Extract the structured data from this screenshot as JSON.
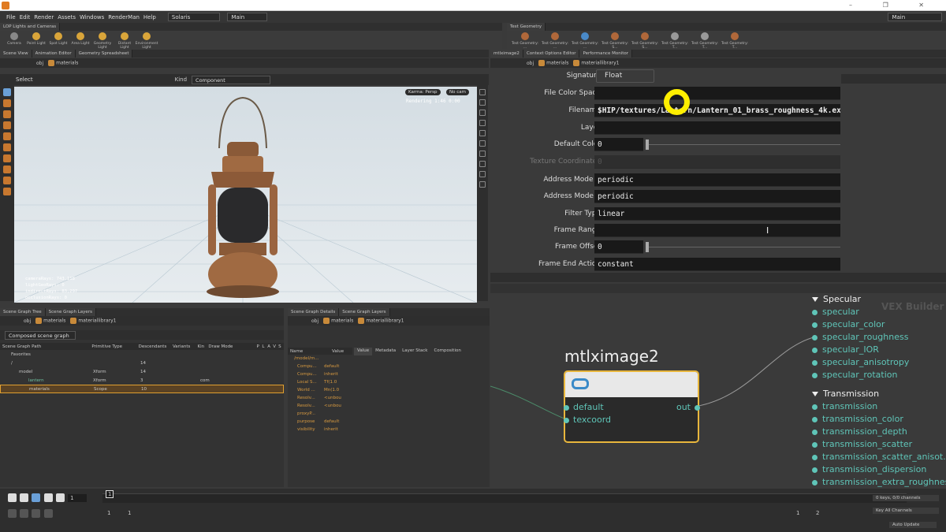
{
  "menu": {
    "items": [
      "File",
      "Edit",
      "Render",
      "Assets",
      "Windows",
      "RenderMan",
      "Help"
    ],
    "desktop_left": "Solaris",
    "desktop_mid": "Main",
    "desktop_right": "Main"
  },
  "shelf_left": {
    "tab": "LOP Lights and Cameras",
    "tools": [
      "Camera",
      "Point Light",
      "Spot Light",
      "Area Light",
      "Geometry Light",
      "Distant Light",
      "Environment Light"
    ]
  },
  "shelf_right": {
    "tab": "Test Geometry",
    "tools": [
      "Test Geometry: ...",
      "Test Geometry: ...",
      "Test Geometry: ...",
      "Test Geometry: S...",
      "Test Geometry: S...",
      "Test Geometry: T...",
      "Test Geometry: T...",
      "Test Geometry: T..."
    ]
  },
  "left_panel": {
    "tabs": [
      "Scene View",
      "Animation Editor",
      "Geometry Spreadsheet"
    ],
    "path": [
      "obj",
      "materials"
    ],
    "select_label": "Select",
    "kind_label": "Kind",
    "kind_value": "Component",
    "camera_menu": "Karma: Persp",
    "cam_menu": "No cam",
    "render_status": "Rendering 1:46 0:00",
    "stats": [
      {
        "label": "cameraRays:",
        "value": "743,118"
      },
      {
        "label": "lightGeoRays:",
        "value": "0"
      },
      {
        "label": "indirectRays:",
        "value": "83,297"
      },
      {
        "label": "occlusionRays:",
        "value": "0"
      }
    ]
  },
  "param_panel": {
    "tabs": [
      "mtlximage2",
      "Context Options Editor",
      "Performance Monitor"
    ],
    "path": [
      "obj",
      "materials",
      "materiallibrary1"
    ],
    "rows": [
      {
        "label": "Signature",
        "value": "Float",
        "kind": "menu"
      },
      {
        "label": "File Color Space",
        "value": "",
        "kind": "field"
      },
      {
        "label": "Filename",
        "value": "$HIP/textures/Lantern/Lantern_01_brass_roughness_4k.exr",
        "kind": "field"
      },
      {
        "label": "Layer",
        "value": "",
        "kind": "field"
      },
      {
        "label": "Default Color",
        "value": "0",
        "kind": "slider"
      },
      {
        "label": "Texture Coordinates",
        "value": "0",
        "kind": "dim"
      },
      {
        "label": "Address Mode U",
        "value": "periodic",
        "kind": "field"
      },
      {
        "label": "Address Mode V",
        "value": "periodic",
        "kind": "field"
      },
      {
        "label": "Filter Type",
        "value": "linear",
        "kind": "field"
      },
      {
        "label": "Frame Range",
        "value": "",
        "kind": "field"
      },
      {
        "label": "Frame Offset",
        "value": "0",
        "kind": "slider"
      },
      {
        "label": "Frame End Action",
        "value": "constant",
        "kind": "field"
      }
    ]
  },
  "network": {
    "node_name": "mtlximage2",
    "inputs": [
      "default",
      "texcoord"
    ],
    "output": "out",
    "builder_label": "VEX Builder",
    "groups": [
      {
        "name": "Specular",
        "items": [
          "specular",
          "specular_color",
          "specular_roughness",
          "specular_IOR",
          "specular_anisotropy",
          "specular_rotation"
        ]
      },
      {
        "name": "Transmission",
        "items": [
          "transmission",
          "transmission_color",
          "transmission_depth",
          "transmission_scatter",
          "transmission_scatter_anisot...",
          "transmission_dispersion",
          "transmission_extra_roughness"
        ]
      }
    ]
  },
  "scene_graph": {
    "tabs": [
      "Scene Graph Tree",
      "Scene Graph Layers"
    ],
    "path": [
      "obj",
      "materials",
      "materiallibrary1"
    ],
    "filter": "Composed scene graph",
    "columns": [
      "Scene Graph Path",
      "Primitive Type",
      "Descendants",
      "Variants",
      "Kin",
      "Draw Mode",
      "P",
      "L",
      "A",
      "V",
      "S"
    ],
    "rows": [
      {
        "name": "Favorites",
        "type": "",
        "desc": "",
        "kind": ""
      },
      {
        "name": "/",
        "type": "",
        "desc": "14",
        "kind": ""
      },
      {
        "name": "model",
        "type": "Xform",
        "desc": "14",
        "kind": ""
      },
      {
        "name": "lantern",
        "type": "Xform",
        "desc": "3",
        "kind": "com"
      },
      {
        "name": "materials",
        "type": "Scope",
        "desc": "10",
        "kind": ""
      }
    ]
  },
  "details": {
    "tabs": [
      "Scene Graph Details",
      "Scene Graph Layers"
    ],
    "path": [
      "obj",
      "materials",
      "materiallibrary1"
    ],
    "columns": [
      "Name",
      "Value"
    ],
    "subtabs": [
      "Value",
      "Metadata",
      "Layer Stack",
      "Composition"
    ],
    "root": "/model/m...",
    "rows": [
      {
        "name": "Compu...",
        "value": "default"
      },
      {
        "name": "Compu...",
        "value": "inherit"
      },
      {
        "name": "Local S...",
        "value": "Tf(1.0"
      },
      {
        "name": "World ...",
        "value": "Mn(1.0"
      },
      {
        "name": "Resolv...",
        "value": "<unbou"
      },
      {
        "name": "Resolv...",
        "value": "<unbou"
      },
      {
        "name": "proxyP...",
        "value": ""
      },
      {
        "name": "purpose",
        "value": "default"
      },
      {
        "name": "visibility",
        "value": "inherit"
      }
    ]
  },
  "timeline": {
    "frame": "1",
    "start": "1",
    "end": "1",
    "range_end": "2",
    "range_start": "1",
    "keys_label": "0 keys, 0/0 channels",
    "key_all": "Key All Channels",
    "auto_update": "Auto Update"
  }
}
